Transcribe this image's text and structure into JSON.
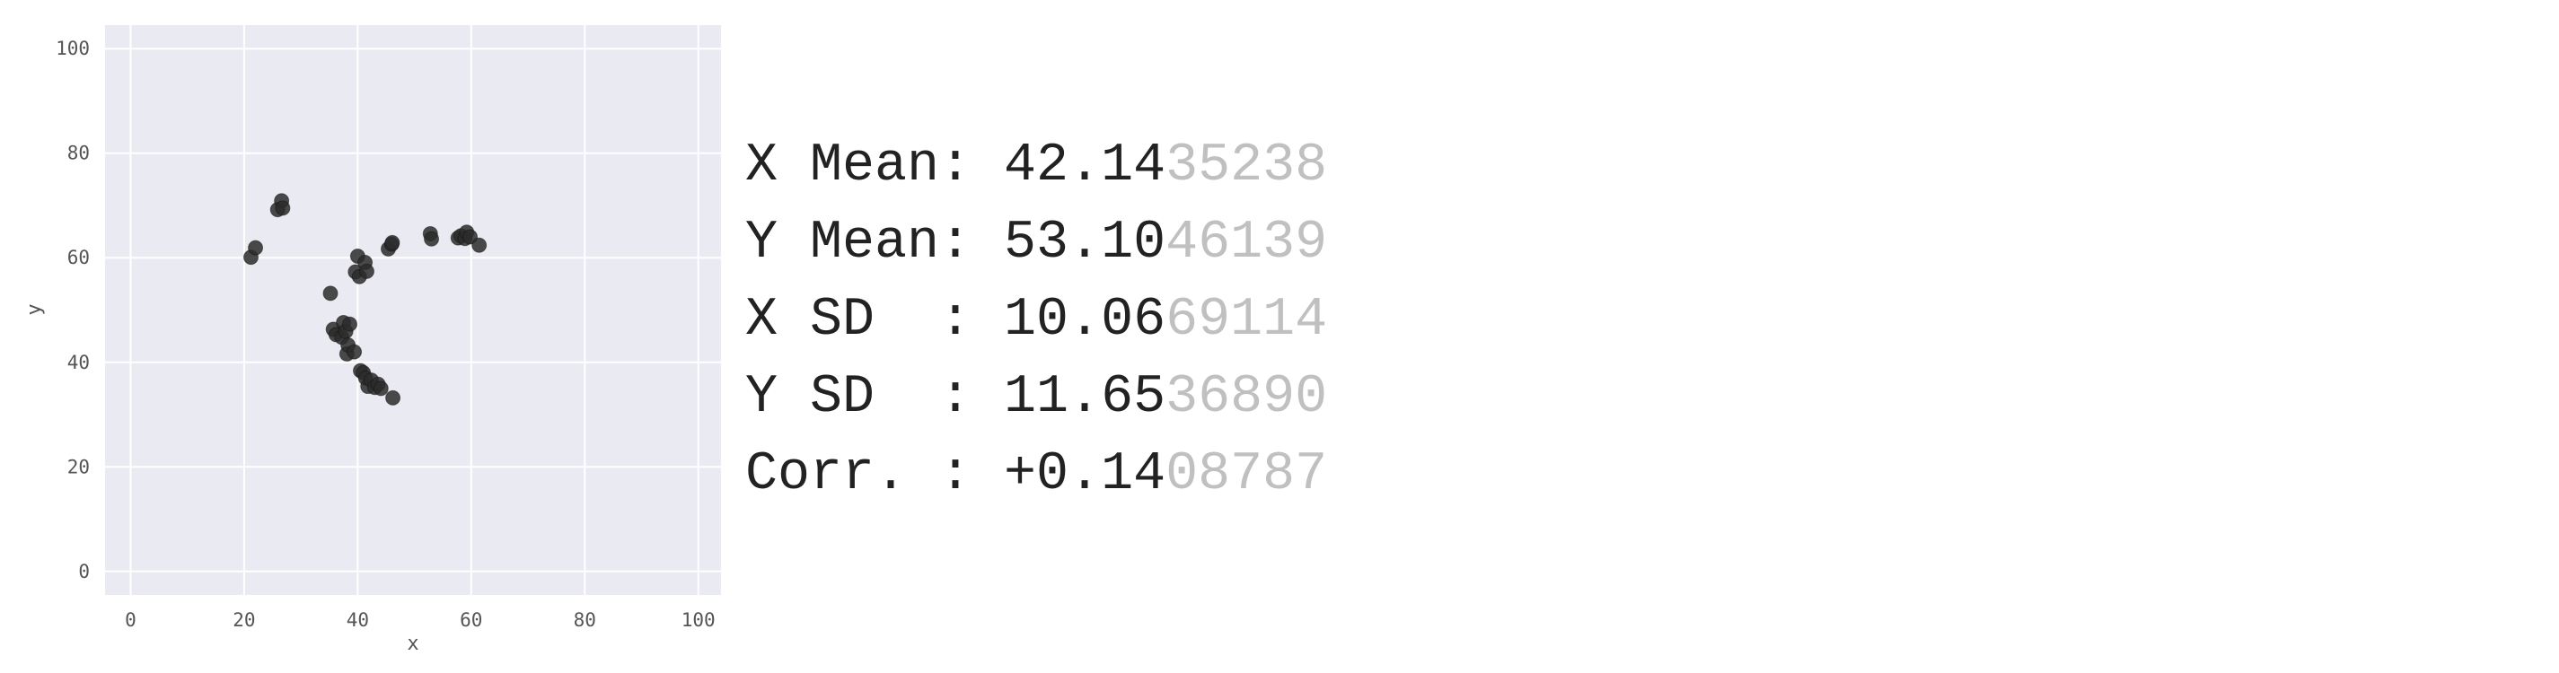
{
  "chart_data": {
    "type": "scatter",
    "xlabel": "x",
    "ylabel": "y",
    "xlim": [
      -4.5,
      104
    ],
    "ylim": [
      -4.5,
      104.5
    ],
    "xticks": [
      "0",
      "20",
      "40",
      "60",
      "80",
      "100"
    ],
    "yticks": [
      "0",
      "20",
      "40",
      "60",
      "80",
      "100"
    ],
    "grid": true,
    "background": "#eaeaf2",
    "point_color": "#2b2b2b",
    "points": [
      [
        21.2,
        60.1
      ],
      [
        22.0,
        61.9
      ],
      [
        25.9,
        69.2
      ],
      [
        26.6,
        70.9
      ],
      [
        26.8,
        69.5
      ],
      [
        35.2,
        53.2
      ],
      [
        35.7,
        46.3
      ],
      [
        36.2,
        45.3
      ],
      [
        37.2,
        44.8
      ],
      [
        37.5,
        47.6
      ],
      [
        37.9,
        45.9
      ],
      [
        38.1,
        41.6
      ],
      [
        38.3,
        43.3
      ],
      [
        38.6,
        47.3
      ],
      [
        39.4,
        42.0
      ],
      [
        39.6,
        57.3
      ],
      [
        40.0,
        60.3
      ],
      [
        40.3,
        56.4
      ],
      [
        40.5,
        38.4
      ],
      [
        41.0,
        38.0
      ],
      [
        41.3,
        59.1
      ],
      [
        41.6,
        57.4
      ],
      [
        41.4,
        37.0
      ],
      [
        41.8,
        35.4
      ],
      [
        42.4,
        36.6
      ],
      [
        43.0,
        35.2
      ],
      [
        43.6,
        35.8
      ],
      [
        44.1,
        35.0
      ],
      [
        45.4,
        61.7
      ],
      [
        46.0,
        62.6
      ],
      [
        46.1,
        62.9
      ],
      [
        46.2,
        33.2
      ],
      [
        52.8,
        64.6
      ],
      [
        53.0,
        63.6
      ],
      [
        57.7,
        63.8
      ],
      [
        58.2,
        64.2
      ],
      [
        58.9,
        63.7
      ],
      [
        59.2,
        64.9
      ],
      [
        59.8,
        64.0
      ],
      [
        61.4,
        62.4
      ]
    ]
  },
  "stats": [
    {
      "label": "X Mean: ",
      "strong": "42.14",
      "faded": "35238"
    },
    {
      "label": "Y Mean: ",
      "strong": "53.10",
      "faded": "46139"
    },
    {
      "label": "X SD  : ",
      "strong": "10.06",
      "faded": "69114"
    },
    {
      "label": "Y SD  : ",
      "strong": "11.65",
      "faded": "36890"
    },
    {
      "label": "Corr. : ",
      "strong": "+0.14",
      "faded": "08787"
    }
  ]
}
